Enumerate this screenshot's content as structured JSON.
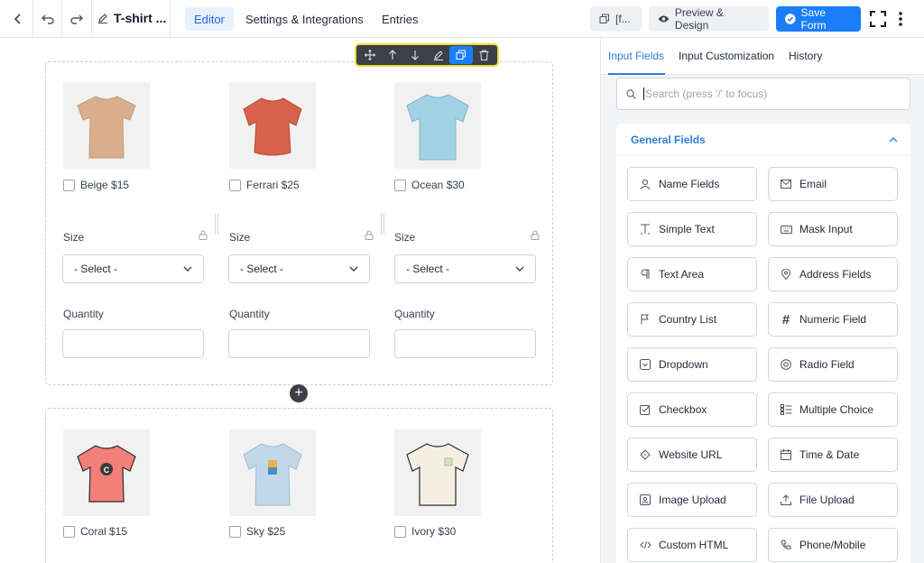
{
  "topbar": {
    "form_title": "T-shirt ...",
    "tabs": [
      {
        "label": "Editor",
        "active": true
      },
      {
        "label": "Settings & Integrations",
        "active": false
      },
      {
        "label": "Entries",
        "active": false
      }
    ],
    "shortcode_label": "[f...",
    "preview_label": "Preview & Design",
    "save_label": "Save Form"
  },
  "toolbar": {
    "icons": [
      "move-icon",
      "arrow-up-icon",
      "arrow-down-icon",
      "edit-icon",
      "duplicate-icon",
      "trash-icon"
    ]
  },
  "rows": [
    {
      "products": [
        {
          "label": "Beige $15",
          "color": "#d9ae8c"
        },
        {
          "label": "Ferrari $25",
          "color": "#d9614a"
        },
        {
          "label": "Ocean $30",
          "color": "#a2d2e5"
        }
      ],
      "size_label": "Size",
      "select_placeholder": "- Select -",
      "quantity_label": "Quantity"
    },
    {
      "products": [
        {
          "label": "Coral $15",
          "color": "#f2807a"
        },
        {
          "label": "Sky $25",
          "color": "#c0d8ea"
        },
        {
          "label": "Ivory $30",
          "color": "#f3efe2"
        }
      ]
    }
  ],
  "sidebar": {
    "tabs": [
      {
        "label": "Input Fields",
        "active": true
      },
      {
        "label": "Input Customization",
        "active": false
      },
      {
        "label": "History",
        "active": false
      }
    ],
    "search_placeholder": "Search (press '/' to focus)",
    "section_title": "General Fields",
    "fields": [
      {
        "label": "Name Fields",
        "icon": "user-icon"
      },
      {
        "label": "Email",
        "icon": "envelope-icon"
      },
      {
        "label": "Simple Text",
        "icon": "text-cursor-icon"
      },
      {
        "label": "Mask Input",
        "icon": "keyboard-icon"
      },
      {
        "label": "Text Area",
        "icon": "paragraph-icon"
      },
      {
        "label": "Address Fields",
        "icon": "location-pin-icon"
      },
      {
        "label": "Country List",
        "icon": "flag-icon"
      },
      {
        "label": "Numeric Field",
        "icon": "hash-icon"
      },
      {
        "label": "Dropdown",
        "icon": "dropdown-icon"
      },
      {
        "label": "Radio Field",
        "icon": "radio-icon"
      },
      {
        "label": "Checkbox",
        "icon": "checkbox-icon"
      },
      {
        "label": "Multiple Choice",
        "icon": "list-icon"
      },
      {
        "label": "Website URL",
        "icon": "link-icon"
      },
      {
        "label": "Time & Date",
        "icon": "calendar-icon"
      },
      {
        "label": "Image Upload",
        "icon": "image-icon"
      },
      {
        "label": "File Upload",
        "icon": "upload-icon"
      },
      {
        "label": "Custom HTML",
        "icon": "code-icon"
      },
      {
        "label": "Phone/Mobile",
        "icon": "phone-icon"
      }
    ]
  }
}
